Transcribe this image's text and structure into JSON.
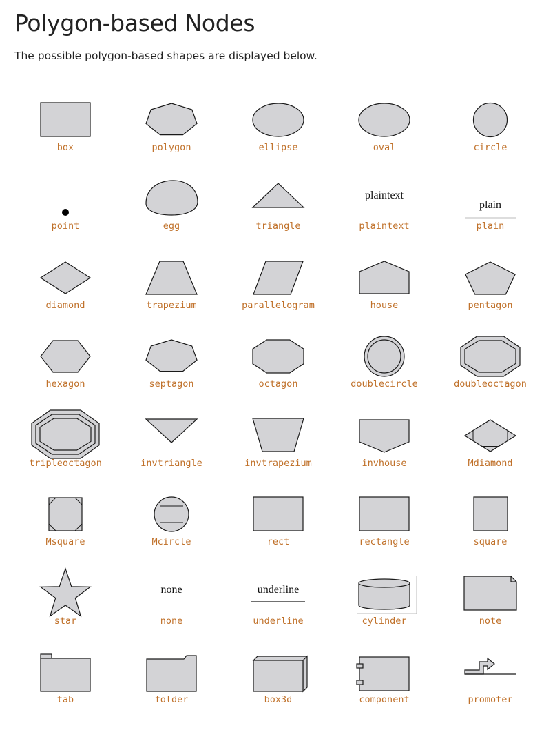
{
  "title": "Polygon-based Nodes",
  "intro": "The possible polygon-based shapes are displayed below.",
  "colors": {
    "fill": "#d3d3d6",
    "stroke": "#1a1a1a",
    "label": "#c0712a",
    "heading": "#222222"
  },
  "shapes": [
    {
      "label": "box",
      "glyph": "box"
    },
    {
      "label": "polygon",
      "glyph": "polygon"
    },
    {
      "label": "ellipse",
      "glyph": "ellipse"
    },
    {
      "label": "oval",
      "glyph": "oval"
    },
    {
      "label": "circle",
      "glyph": "circle"
    },
    {
      "label": "point",
      "glyph": "point"
    },
    {
      "label": "egg",
      "glyph": "egg"
    },
    {
      "label": "triangle",
      "glyph": "triangle"
    },
    {
      "label": "plaintext",
      "glyph": "plaintext",
      "text": "plaintext"
    },
    {
      "label": "plain",
      "glyph": "plain",
      "text": "plain"
    },
    {
      "label": "diamond",
      "glyph": "diamond"
    },
    {
      "label": "trapezium",
      "glyph": "trapezium"
    },
    {
      "label": "parallelogram",
      "glyph": "parallelogram"
    },
    {
      "label": "house",
      "glyph": "house"
    },
    {
      "label": "pentagon",
      "glyph": "pentagon"
    },
    {
      "label": "hexagon",
      "glyph": "hexagon"
    },
    {
      "label": "septagon",
      "glyph": "septagon"
    },
    {
      "label": "octagon",
      "glyph": "octagon"
    },
    {
      "label": "doublecircle",
      "glyph": "doublecircle"
    },
    {
      "label": "doubleoctagon",
      "glyph": "doubleoctagon"
    },
    {
      "label": "tripleoctagon",
      "glyph": "tripleoctagon"
    },
    {
      "label": "invtriangle",
      "glyph": "invtriangle"
    },
    {
      "label": "invtrapezium",
      "glyph": "invtrapezium"
    },
    {
      "label": "invhouse",
      "glyph": "invhouse"
    },
    {
      "label": "Mdiamond",
      "glyph": "Mdiamond"
    },
    {
      "label": "Msquare",
      "glyph": "Msquare"
    },
    {
      "label": "Mcircle",
      "glyph": "Mcircle"
    },
    {
      "label": "rect",
      "glyph": "rect"
    },
    {
      "label": "rectangle",
      "glyph": "rectangle"
    },
    {
      "label": "square",
      "glyph": "square"
    },
    {
      "label": "star",
      "glyph": "star"
    },
    {
      "label": "none",
      "glyph": "none",
      "text": "none"
    },
    {
      "label": "underline",
      "glyph": "underline",
      "text": "underline"
    },
    {
      "label": "cylinder",
      "glyph": "cylinder"
    },
    {
      "label": "note",
      "glyph": "note"
    },
    {
      "label": "tab",
      "glyph": "tab"
    },
    {
      "label": "folder",
      "glyph": "folder"
    },
    {
      "label": "box3d",
      "glyph": "box3d"
    },
    {
      "label": "component",
      "glyph": "component"
    },
    {
      "label": "promoter",
      "glyph": "promoter"
    }
  ]
}
